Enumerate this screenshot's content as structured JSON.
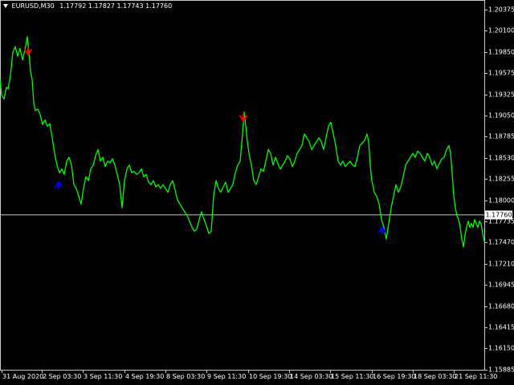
{
  "header": {
    "symbol": "EURUSD,M30",
    "ohlc": "1.17792 1.17827 1.17743 1.17760"
  },
  "colors": {
    "background": "#000000",
    "price_line": "#00ff00",
    "sell_arrow": "#ff0000",
    "buy_arrow": "#0000ff",
    "axis": "#c8c8c8"
  },
  "chart_data": {
    "type": "line",
    "title": "",
    "symbol": "EURUSD",
    "timeframe": "M30",
    "y_ticks": [
      "1.20375",
      "1.20100",
      "1.19850",
      "1.19575",
      "1.19325",
      "1.19050",
      "1.18785",
      "1.18530",
      "1.18255",
      "1.18000",
      "1.17735",
      "1.17470",
      "1.17210",
      "1.16945",
      "1.16680",
      "1.16415",
      "1.16150",
      "1.15885"
    ],
    "x_ticks": [
      "31 Aug 2020",
      "2 Sep 03:30",
      "3 Sep 11:30",
      "4 Sep 19:30",
      "8 Sep 03:30",
      "9 Sep 11:30",
      "10 Sep 19:30",
      "14 Sep 03:30",
      "15 Sep 11:30",
      "16 Sep 19:30",
      "18 Sep 03:30",
      "21 Sep 11:30"
    ],
    "current_price": "1.17760",
    "ylim": [
      1.1576,
      1.205
    ],
    "series": [
      {
        "values": [
          [
            0,
            1.195
          ],
          [
            2,
            1.193
          ],
          [
            5,
            1.1925
          ],
          [
            8,
            1.194
          ],
          [
            10,
            1.1938
          ],
          [
            13,
            1.1955
          ],
          [
            16,
            1.1985
          ],
          [
            19,
            1.1992
          ],
          [
            22,
            1.198
          ],
          [
            25,
            1.199
          ],
          [
            28,
            1.1975
          ],
          [
            31,
            1.1988
          ],
          [
            34,
            1.2005
          ],
          [
            36,
            1.1985
          ],
          [
            38,
            1.196
          ],
          [
            40,
            1.195
          ],
          [
            42,
            1.192
          ],
          [
            44,
            1.191
          ],
          [
            47,
            1.1912
          ],
          [
            50,
            1.1905
          ],
          [
            53,
            1.1892
          ],
          [
            56,
            1.1898
          ],
          [
            59,
            1.189
          ],
          [
            62,
            1.1893
          ],
          [
            65,
            1.1875
          ],
          [
            68,
            1.1855
          ],
          [
            71,
            1.184
          ],
          [
            74,
            1.183
          ],
          [
            77,
            1.1835
          ],
          [
            80,
            1.1828
          ],
          [
            83,
            1.1845
          ],
          [
            86,
            1.185
          ],
          [
            89,
            1.184
          ],
          [
            92,
            1.1815
          ],
          [
            95,
            1.181
          ],
          [
            98,
            1.18
          ],
          [
            101,
            1.179
          ],
          [
            104,
            1.181
          ],
          [
            107,
            1.1825
          ],
          [
            110,
            1.182
          ],
          [
            113,
            1.1835
          ],
          [
            116,
            1.184
          ],
          [
            119,
            1.1852
          ],
          [
            122,
            1.186
          ],
          [
            125,
            1.1845
          ],
          [
            128,
            1.185
          ],
          [
            131,
            1.1838
          ],
          [
            134,
            1.1845
          ],
          [
            137,
            1.1843
          ],
          [
            140,
            1.1848
          ],
          [
            143,
            1.184
          ],
          [
            146,
            1.1828
          ],
          [
            149,
            1.1815
          ],
          [
            152,
            1.1785
          ],
          [
            155,
            1.182
          ],
          [
            158,
            1.1835
          ],
          [
            161,
            1.184
          ],
          [
            164,
            1.183
          ],
          [
            167,
            1.1832
          ],
          [
            170,
            1.1828
          ],
          [
            173,
            1.183
          ],
          [
            176,
            1.1835
          ],
          [
            179,
            1.1825
          ],
          [
            182,
            1.1828
          ],
          [
            185,
            1.1818
          ],
          [
            188,
            1.1815
          ],
          [
            191,
            1.182
          ],
          [
            194,
            1.1812
          ],
          [
            197,
            1.1815
          ],
          [
            200,
            1.181
          ],
          [
            203,
            1.1815
          ],
          [
            206,
            1.181
          ],
          [
            209,
            1.1805
          ],
          [
            212,
            1.1815
          ],
          [
            215,
            1.182
          ],
          [
            218,
            1.1808
          ],
          [
            221,
            1.1795
          ],
          [
            224,
            1.179
          ],
          [
            227,
            1.1785
          ],
          [
            230,
            1.178
          ],
          [
            233,
            1.1775
          ],
          [
            236,
            1.1768
          ],
          [
            239,
            1.176
          ],
          [
            242,
            1.1755
          ],
          [
            245,
            1.1758
          ],
          [
            248,
            1.177
          ],
          [
            251,
            1.178
          ],
          [
            254,
            1.177
          ],
          [
            257,
            1.1762
          ],
          [
            260,
            1.1752
          ],
          [
            263,
            1.1755
          ],
          [
            266,
            1.18
          ],
          [
            269,
            1.182
          ],
          [
            272,
            1.181
          ],
          [
            275,
            1.1805
          ],
          [
            278,
            1.1812
          ],
          [
            281,
            1.1818
          ],
          [
            284,
            1.1805
          ],
          [
            287,
            1.181
          ],
          [
            290,
            1.1815
          ],
          [
            293,
            1.183
          ],
          [
            296,
            1.184
          ],
          [
            299,
            1.1845
          ],
          [
            302,
            1.188
          ],
          [
            304,
            1.1908
          ],
          [
            306,
            1.189
          ],
          [
            308,
            1.187
          ],
          [
            310,
            1.1855
          ],
          [
            313,
            1.184
          ],
          [
            316,
            1.182
          ],
          [
            319,
            1.1815
          ],
          [
            322,
            1.1825
          ],
          [
            325,
            1.1835
          ],
          [
            328,
            1.1832
          ],
          [
            331,
            1.1845
          ],
          [
            334,
            1.186
          ],
          [
            337,
            1.1855
          ],
          [
            340,
            1.184
          ],
          [
            343,
            1.185
          ],
          [
            346,
            1.1842
          ],
          [
            349,
            1.1835
          ],
          [
            352,
            1.184
          ],
          [
            355,
            1.1845
          ],
          [
            358,
            1.1852
          ],
          [
            361,
            1.1848
          ],
          [
            364,
            1.1838
          ],
          [
            367,
            1.1845
          ],
          [
            370,
            1.1855
          ],
          [
            373,
            1.186
          ],
          [
            376,
            1.1865
          ],
          [
            379,
            1.188
          ],
          [
            382,
            1.1875
          ],
          [
            385,
            1.187
          ],
          [
            388,
            1.186
          ],
          [
            391,
            1.1865
          ],
          [
            394,
            1.187
          ],
          [
            397,
            1.1875
          ],
          [
            400,
            1.187
          ],
          [
            403,
            1.186
          ],
          [
            406,
            1.1875
          ],
          [
            409,
            1.189
          ],
          [
            412,
            1.1895
          ],
          [
            415,
            1.188
          ],
          [
            418,
            1.1865
          ],
          [
            421,
            1.1845
          ],
          [
            424,
            1.184
          ],
          [
            427,
            1.1845
          ],
          [
            430,
            1.1838
          ],
          [
            433,
            1.1842
          ],
          [
            436,
            1.1845
          ],
          [
            439,
            1.184
          ],
          [
            442,
            1.1838
          ],
          [
            445,
            1.185
          ],
          [
            448,
            1.1865
          ],
          [
            451,
            1.1868
          ],
          [
            454,
            1.1872
          ],
          [
            457,
            1.188
          ],
          [
            459,
            1.187
          ],
          [
            461,
            1.184
          ],
          [
            463,
            1.182
          ],
          [
            466,
            1.1805
          ],
          [
            469,
            1.18
          ],
          [
            472,
            1.179
          ],
          [
            475,
            1.177
          ],
          [
            478,
            1.176
          ],
          [
            481,
            1.1745
          ],
          [
            484,
            1.1765
          ],
          [
            487,
            1.1785
          ],
          [
            490,
            1.18
          ],
          [
            493,
            1.1815
          ],
          [
            496,
            1.1805
          ],
          [
            499,
            1.1812
          ],
          [
            502,
            1.1825
          ],
          [
            505,
            1.184
          ],
          [
            508,
            1.1845
          ],
          [
            511,
            1.185
          ],
          [
            514,
            1.1855
          ],
          [
            517,
            1.185
          ],
          [
            520,
            1.1858
          ],
          [
            523,
            1.1855
          ],
          [
            526,
            1.185
          ],
          [
            529,
            1.1845
          ],
          [
            532,
            1.1855
          ],
          [
            535,
            1.185
          ],
          [
            538,
            1.184
          ],
          [
            541,
            1.1845
          ],
          [
            544,
            1.1835
          ],
          [
            547,
            1.1842
          ],
          [
            550,
            1.1848
          ],
          [
            553,
            1.185
          ],
          [
            556,
            1.186
          ],
          [
            559,
            1.1865
          ],
          [
            561,
            1.1855
          ],
          [
            563,
            1.183
          ],
          [
            565,
            1.18
          ],
          [
            567,
            1.1785
          ],
          [
            569,
            1.1775
          ],
          [
            571,
            1.177
          ],
          [
            573,
            1.176
          ],
          [
            575,
            1.1745
          ],
          [
            577,
            1.1735
          ],
          [
            579,
            1.175
          ],
          [
            581,
            1.176
          ],
          [
            583,
            1.1768
          ],
          [
            585,
            1.176
          ],
          [
            587,
            1.1765
          ],
          [
            589,
            1.176
          ],
          [
            591,
            1.177
          ],
          [
            593,
            1.1765
          ],
          [
            595,
            1.176
          ],
          [
            597,
            1.1768
          ],
          [
            599,
            1.1765
          ],
          [
            601,
            1.1752
          ],
          [
            603,
            1.1742
          ]
        ]
      }
    ],
    "sell_arrows": [
      [
        35,
        1.1985
      ],
      [
        303,
        1.19
      ]
    ],
    "buy_arrows": [
      [
        73,
        1.1815
      ],
      [
        476,
        1.1757
      ]
    ]
  }
}
